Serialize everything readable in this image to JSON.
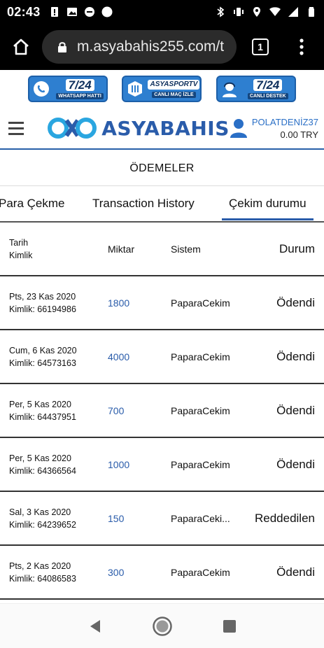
{
  "status_bar": {
    "time": "02:43"
  },
  "browser": {
    "url": "m.asyabahis255.com/t",
    "tab_count": "1"
  },
  "banners": [
    {
      "main": "7/24",
      "sub": "WHATSAPP HATTI"
    },
    {
      "main": "ASYASPORTV",
      "sub": "CANLI MAÇ İZLE"
    },
    {
      "main": "7/24",
      "sub": "CANLI DESTEK"
    }
  ],
  "header": {
    "logo_text": "ASYABAHIS",
    "username": "POLATDENİZ37",
    "balance": "0.00 TRY"
  },
  "page": {
    "title": "ÖDEMELER"
  },
  "tabs": [
    {
      "label": "Para Çekme"
    },
    {
      "label": "Transaction History"
    },
    {
      "label": "Çekim durumu"
    }
  ],
  "table": {
    "headers": {
      "date": "Tarih",
      "id": "Kimlik",
      "amount": "Miktar",
      "system": "Sistem",
      "status": "Durum"
    },
    "rows": [
      {
        "date": "Pts, 23 Kas 2020",
        "id": "Kimlik: 66194986",
        "amount": "1800",
        "system": "PaparaCekim",
        "status": "Ödendi"
      },
      {
        "date": "Cum, 6 Kas 2020",
        "id": "Kimlik: 64573163",
        "amount": "4000",
        "system": "PaparaCekim",
        "status": "Ödendi"
      },
      {
        "date": "Per, 5 Kas 2020",
        "id": "Kimlik: 64437951",
        "amount": "700",
        "system": "PaparaCekim",
        "status": "Ödendi"
      },
      {
        "date": "Per, 5 Kas 2020",
        "id": "Kimlik: 64366564",
        "amount": "1000",
        "system": "PaparaCekim",
        "status": "Ödendi"
      },
      {
        "date": "Sal, 3 Kas 2020",
        "id": "Kimlik: 64239652",
        "amount": "150",
        "system": "PaparaCeki...",
        "status": "Reddedilen"
      },
      {
        "date": "Pts, 2 Kas 2020",
        "id": "Kimlik: 64086583",
        "amount": "300",
        "system": "PaparaCekim",
        "status": "Ödendi"
      }
    ]
  },
  "colors": {
    "brand_blue": "#2a5caa",
    "amount_blue": "#2a5caa",
    "status_bar": "#000000"
  }
}
